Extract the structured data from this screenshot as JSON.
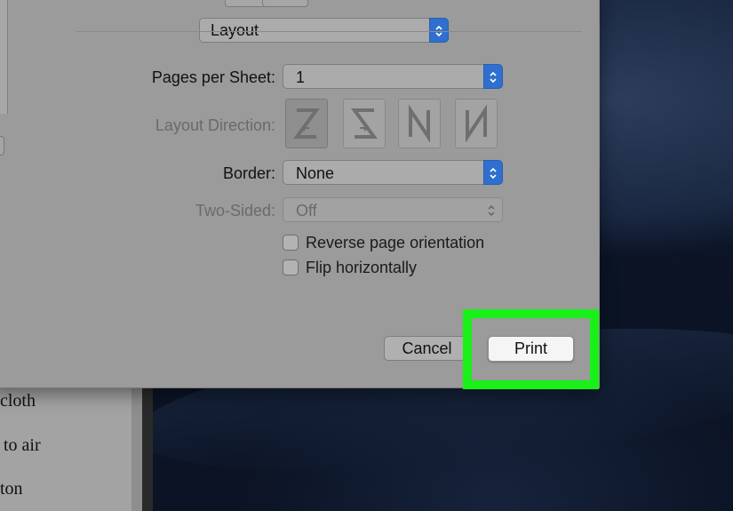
{
  "document": {
    "lines": [
      "cloth",
      "to air",
      "ton"
    ]
  },
  "dialog": {
    "section_select": {
      "value": "Layout"
    },
    "pages_per_sheet": {
      "label": "Pages per Sheet:",
      "value": "1"
    },
    "layout_direction": {
      "label": "Layout Direction:"
    },
    "border": {
      "label": "Border:",
      "value": "None"
    },
    "two_sided": {
      "label": "Two-Sided:",
      "value": "Off"
    },
    "options": [
      {
        "label": "Reverse page orientation",
        "checked": false
      },
      {
        "label": "Flip horizontally",
        "checked": false
      }
    ],
    "cancel_label": "Cancel",
    "print_label": "Print"
  },
  "colors": {
    "accent": "#2f6fcf",
    "highlight": "#19f01a",
    "dialog_bg": "#9b9b9b"
  }
}
